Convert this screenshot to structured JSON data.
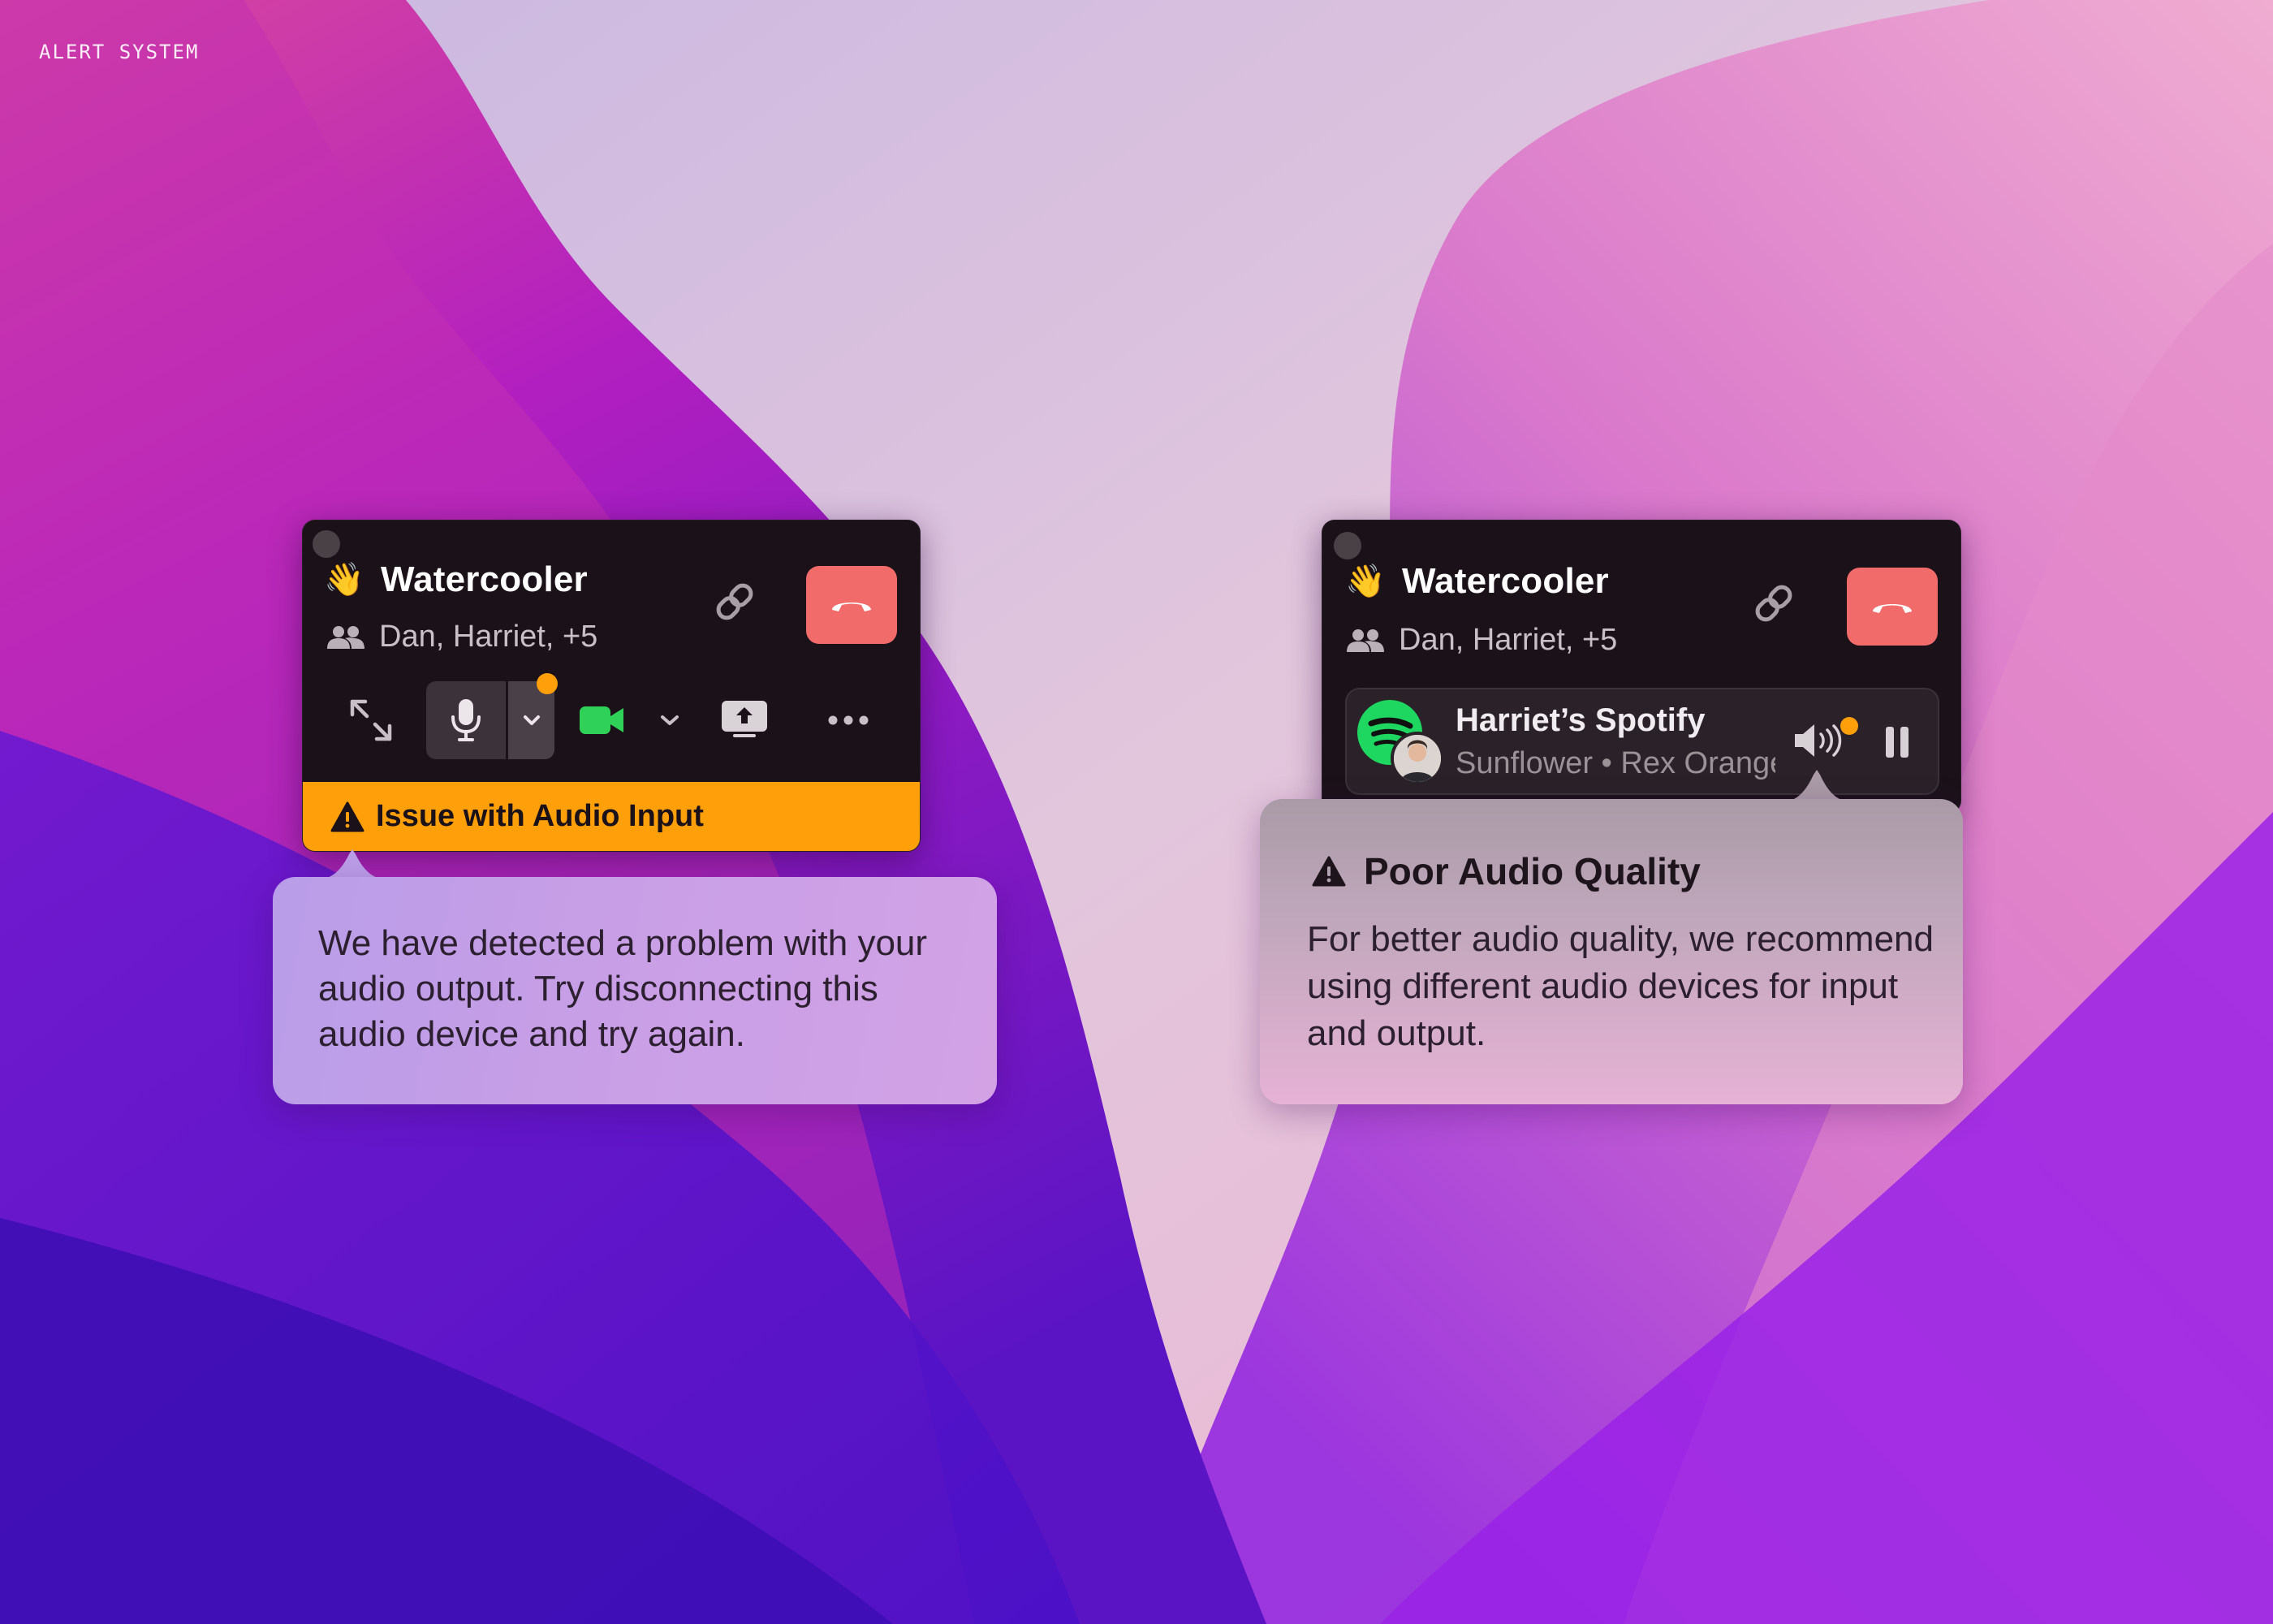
{
  "page": {
    "label": "ALERT SYSTEM"
  },
  "widgets": [
    {
      "emoji": "👋",
      "title": "Watercooler",
      "participants": "Dan, Harriet, +5",
      "alert_bar": {
        "text": "Issue with Audio Input",
        "color": "#ff9f0a"
      },
      "callout": {
        "text": "We have detected a problem with your audio output. Try disconnecting this audio device and try again."
      }
    },
    {
      "emoji": "👋",
      "title": "Watercooler",
      "participants": "Dan, Harriet, +5",
      "spotify": {
        "title": "Harriet’s Spotify",
        "subtitle": "Sunflower • Rex Orange County"
      },
      "callout": {
        "title": "Poor Audio Quality",
        "text": "For better audio quality, we recommend using different audio devices for input and output."
      }
    }
  ],
  "icons": [
    "window-dot-icon",
    "wave-emoji-icon",
    "people-icon",
    "link-icon",
    "hangup-icon",
    "expand-icon",
    "microphone-icon",
    "chevron-down-icon",
    "video-camera-icon",
    "screen-share-icon",
    "more-icon",
    "warning-icon",
    "spotify-icon",
    "avatar",
    "speaker-icon",
    "pause-icon"
  ],
  "colors": {
    "warning": "#ff9f0a",
    "hangup": "#f26b6b",
    "camera": "#30d158",
    "spotify": "#1ed760",
    "widget_bg": "#1b1219"
  }
}
